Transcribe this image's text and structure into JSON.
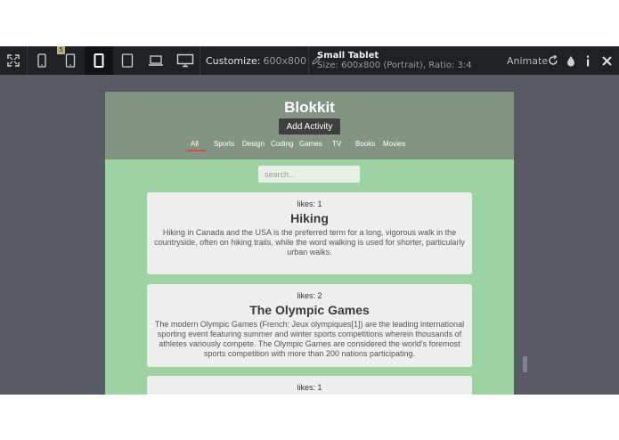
{
  "toolbar": {
    "icons": [
      "fullscreen-icon",
      "phone-icon",
      "phone-landscape-icon",
      "small-tablet-icon",
      "tablet-icon",
      "laptop-icon",
      "desktop-icon"
    ],
    "badge": "5",
    "customize_label": "Customize:",
    "customize_value": "600x800",
    "device_name": "Small Tablet",
    "device_size": "Size: 600x800 (Portrait), Ratio: 3:4",
    "animate_label": "Animate"
  },
  "app": {
    "title": "Blokkit",
    "add_button": "Add Activity",
    "nav": [
      "All",
      "Sports",
      "Design",
      "Coding",
      "Games",
      "TV",
      "Books",
      "Movies"
    ],
    "active_nav": "All",
    "search_placeholder": "search...",
    "cards": [
      {
        "likes": "likes: 1",
        "title": "Hiking",
        "description": "Hiking in Canada and the USA is the preferred term for a long, vigorous walk in the countryside, often on hiking trails, while the word walking is used for shorter, particularly urban walks."
      },
      {
        "likes": "likes: 2",
        "title": "The Olympic Games",
        "description": "The modern Olympic Games (French: Jeux olympiques[1]) are the leading international sporting event featuring summer and winter sports competitions wherein thousands of athletes variously compete. The Olympic Games are considered the world's foremost sports competition with more than 200 nations participating."
      },
      {
        "likes": "likes: 1",
        "title": "",
        "description": ""
      }
    ]
  },
  "colors": {
    "toolbar_bg": "#1f2124",
    "canvas_bg": "#585b66",
    "app_header_bg": "#849483",
    "app_body_bg": "#9dd3a3",
    "card_bg": "#eeeeee",
    "nav_active_underline": "#d24f4f"
  }
}
